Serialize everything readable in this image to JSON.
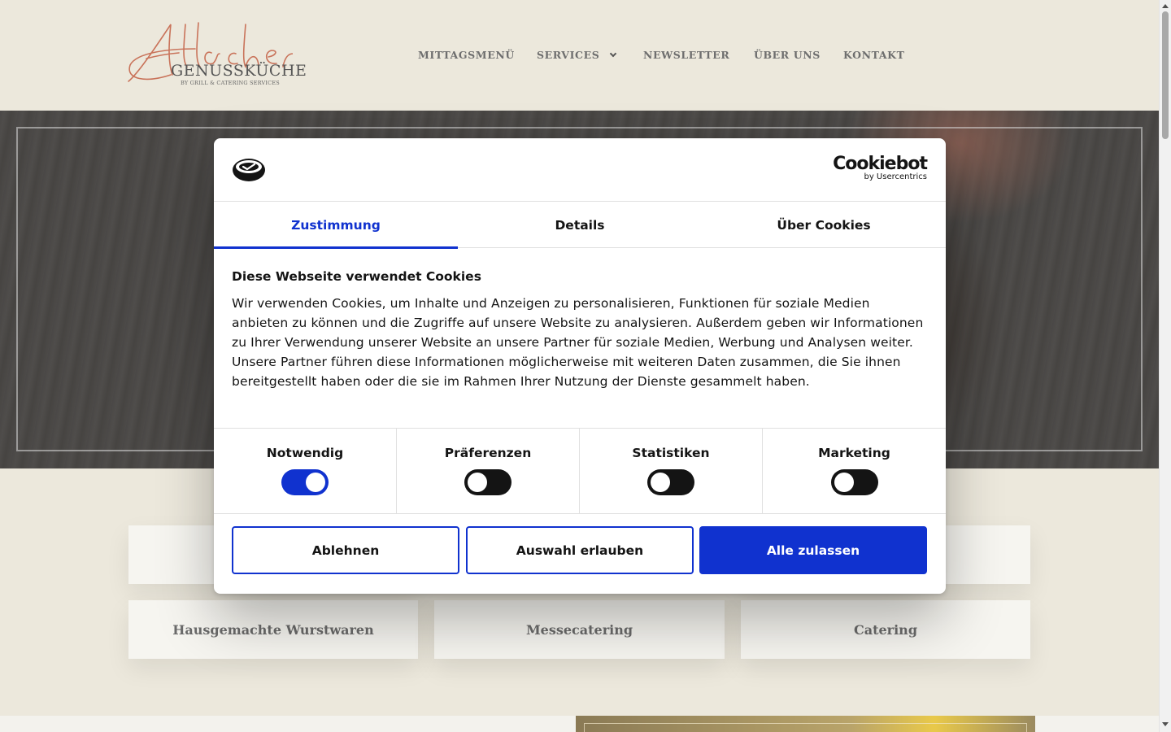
{
  "logo": {
    "script_text": "Allacher",
    "wordmark": "GENUSSKÜCHE",
    "tagline": "BY GRILL & CATERING SERVICES"
  },
  "nav": {
    "items": [
      {
        "label": "MITTAGSMENÜ"
      },
      {
        "label": "SERVICES"
      },
      {
        "label": "NEWSLETTER"
      },
      {
        "label": "ÜBER UNS"
      },
      {
        "label": "KONTAKT"
      }
    ]
  },
  "services": {
    "cards": [
      {
        "label": ""
      },
      {
        "label": ""
      },
      {
        "label": "Hausgemachte Wurstwaren"
      },
      {
        "label": "Messecatering"
      },
      {
        "label": "Catering"
      }
    ]
  },
  "cookie_dialog": {
    "brand": {
      "name": "Cookiebot",
      "sub": "by Usercentrics"
    },
    "tabs": [
      {
        "label": "Zustimmung",
        "active": true
      },
      {
        "label": "Details",
        "active": false
      },
      {
        "label": "Über Cookies",
        "active": false
      }
    ],
    "title": "Diese Webseite verwendet Cookies",
    "text": "Wir verwenden Cookies, um Inhalte und Anzeigen zu personalisieren, Funktionen für soziale Medien anbieten zu können und die Zugriffe auf unsere Website zu analysieren. Außerdem geben wir Informationen zu Ihrer Verwendung unserer Website an unsere Partner für soziale Medien, Werbung und Analysen weiter. Unsere Partner führen diese Informationen möglicherweise mit weiteren Daten zusammen, die Sie ihnen bereitgestellt haben oder die sie im Rahmen Ihrer Nutzung der Dienste gesammelt haben.",
    "categories": [
      {
        "label": "Notwendig",
        "enabled": true
      },
      {
        "label": "Präferenzen",
        "enabled": false
      },
      {
        "label": "Statistiken",
        "enabled": false
      },
      {
        "label": "Marketing",
        "enabled": false
      }
    ],
    "buttons": {
      "decline": "Ablehnen",
      "allow_selection": "Auswahl erlauben",
      "allow_all": "Alle zulassen"
    }
  },
  "colors": {
    "accent": "#1032cf",
    "page_bg": "#ece8dc",
    "logo_script": "#c9735a"
  }
}
